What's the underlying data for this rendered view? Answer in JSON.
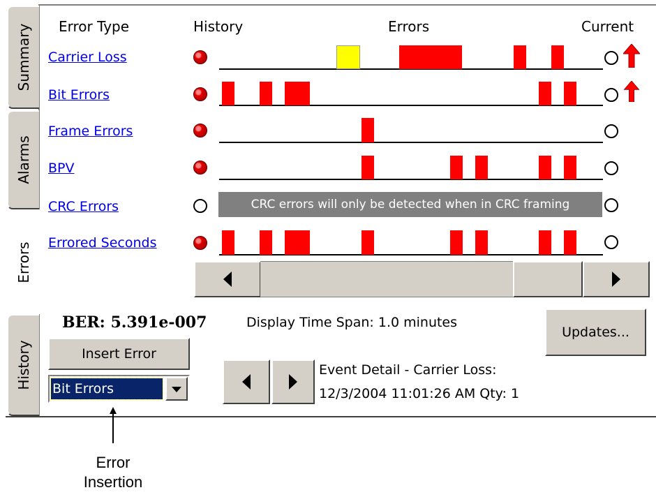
{
  "tabs": [
    {
      "label": "Summary",
      "active": false
    },
    {
      "label": "Alarms",
      "active": false
    },
    {
      "label": "Errors",
      "active": true
    },
    {
      "label": "History",
      "active": false
    }
  ],
  "header": {
    "error_type": "Error Type",
    "history": "History",
    "errors": "Errors",
    "current": "Current"
  },
  "rows": [
    {
      "label": "Carrier Loss",
      "history_alarm": true,
      "current_arrow": true
    },
    {
      "label": "Bit Errors",
      "history_alarm": true,
      "current_arrow": true
    },
    {
      "label": "Frame Errors",
      "history_alarm": true,
      "current_arrow": false
    },
    {
      "label": "BPV",
      "history_alarm": true,
      "current_arrow": false
    },
    {
      "label": "CRC Errors",
      "history_alarm": false,
      "current_arrow": false
    },
    {
      "label": "Errored Seconds",
      "history_alarm": true,
      "current_arrow": false
    }
  ],
  "crc_note": "CRC errors will only be detected when in CRC framing",
  "ber": {
    "label": "BER:",
    "value": "5.391e-007"
  },
  "time_span": "Display Time Span: 1.0 minutes",
  "buttons": {
    "updates": "Updates...",
    "insert_error": "Insert Error"
  },
  "error_select": {
    "value": "Bit Errors"
  },
  "event_detail": {
    "line1": "Event Detail - Carrier Loss:",
    "line2": "12/3/2004 11:01:26 AM Qty: 1"
  },
  "callout": {
    "line1": "Error",
    "line2": "Insertion"
  },
  "colors": {
    "error": "#ff0000",
    "warning": "#ffff00",
    "alarm_led": "#e00000",
    "selection": "#0a246a",
    "button_face": "#d4d0c8",
    "note_bg": "#808080"
  }
}
